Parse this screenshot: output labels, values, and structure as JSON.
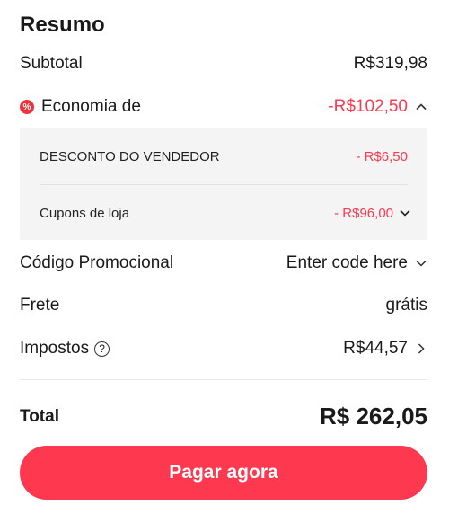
{
  "summary": {
    "title": "Resumo",
    "subtotal": {
      "label": "Subtotal",
      "value": "R$319,98"
    },
    "savings": {
      "label": "Economia de",
      "value": "-R$102,50",
      "badge": "%"
    },
    "discounts": [
      {
        "label": "DESCONTO DO VENDEDOR",
        "value": "- R$6,50"
      },
      {
        "label": "Cupons de loja",
        "value": "- R$96,00"
      }
    ],
    "promo": {
      "label": "Código Promocional",
      "value": "Enter code here"
    },
    "shipping": {
      "label": "Frete",
      "value": "grátis"
    },
    "taxes": {
      "label": "Impostos",
      "help": "?",
      "value": "R$44,57"
    },
    "total": {
      "label": "Total",
      "value": "R$ 262,05"
    },
    "pay_button": "Pagar agora"
  },
  "colors": {
    "accent": "#fd384f",
    "panel_bg": "#f4f4f4"
  },
  "icons": [
    "discount-badge-icon",
    "chevron-up-icon",
    "chevron-down-icon",
    "help-circle-icon",
    "chevron-right-icon"
  ]
}
